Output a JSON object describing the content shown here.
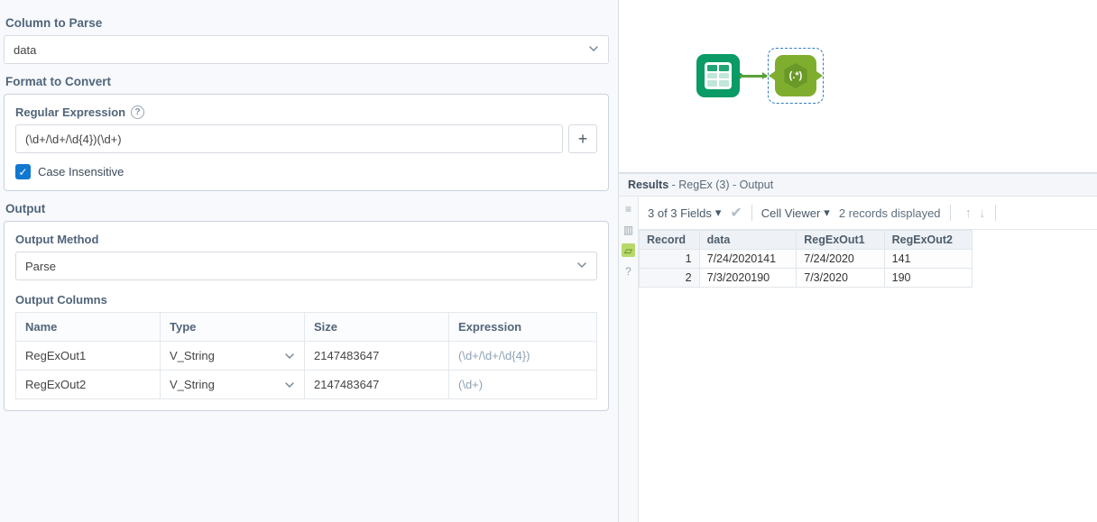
{
  "left": {
    "columnToParse": {
      "label": "Column to Parse",
      "value": "data"
    },
    "formatToConvert": {
      "label": "Format to Convert",
      "regexLabel": "Regular Expression",
      "regexValue": "(\\d+/\\d+/\\d{4})(\\d+)",
      "caseInsensitiveLabel": "Case Insensitive"
    },
    "output": {
      "label": "Output",
      "methodLabel": "Output Method",
      "methodValue": "Parse",
      "columnsLabel": "Output Columns",
      "headers": {
        "name": "Name",
        "type": "Type",
        "size": "Size",
        "expr": "Expression"
      },
      "rows": [
        {
          "name": "RegExOut1",
          "type": "V_String",
          "size": "2147483647",
          "expr": "(\\d+/\\d+/\\d{4})"
        },
        {
          "name": "RegExOut2",
          "type": "V_String",
          "size": "2147483647",
          "expr": "(\\d+)"
        }
      ]
    }
  },
  "right": {
    "resultsTitle": "Results",
    "resultsSub": " - RegEx (3) - Output",
    "toolbar": {
      "fields": "3 of 3 Fields",
      "cellViewer": "Cell Viewer",
      "records": "2 records displayed"
    },
    "headers": {
      "rec": "Record",
      "c1": "data",
      "c2": "RegExOut1",
      "c3": "RegExOut2"
    },
    "rows": [
      {
        "rec": "1",
        "c1": "7/24/2020141",
        "c2": "7/24/2020",
        "c3": "141"
      },
      {
        "rec": "2",
        "c1": "7/3/2020190",
        "c2": "7/3/2020",
        "c3": "190"
      }
    ],
    "canvas": {
      "regexGlyph": "(.*)"
    }
  },
  "chart_data": {
    "type": "table",
    "title": "Results - RegEx (3) - Output",
    "columns": [
      "Record",
      "data",
      "RegExOut1",
      "RegExOut2"
    ],
    "rows": [
      [
        1,
        "7/24/2020141",
        "7/24/2020",
        141
      ],
      [
        2,
        "7/3/2020190",
        "7/3/2020",
        190
      ]
    ],
    "fields_shown": "3 of 3",
    "records_displayed": 2
  }
}
